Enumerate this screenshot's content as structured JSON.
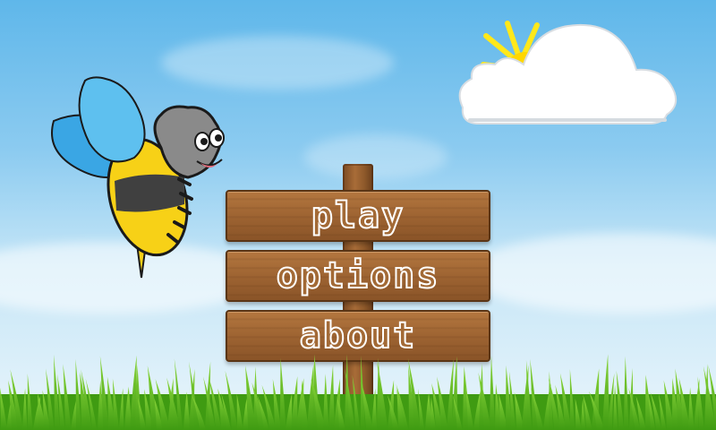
{
  "menu": {
    "items": [
      {
        "id": "play",
        "label": "play"
      },
      {
        "id": "options",
        "label": "options"
      },
      {
        "id": "about",
        "label": "about"
      }
    ]
  },
  "scene": {
    "sky_colors": [
      "#5fb7ea",
      "#e9f5fb"
    ],
    "cloud_color": "#ffffff",
    "sun_color": "#ffe81a",
    "grass_colors": [
      "#3f9b12",
      "#8ad63a"
    ],
    "wood_color": "#9e6432",
    "bee_colors": {
      "body": "#f7d117",
      "stripe": "#404040",
      "wing": "#47b3ea",
      "head": "#8a8a8a"
    }
  }
}
